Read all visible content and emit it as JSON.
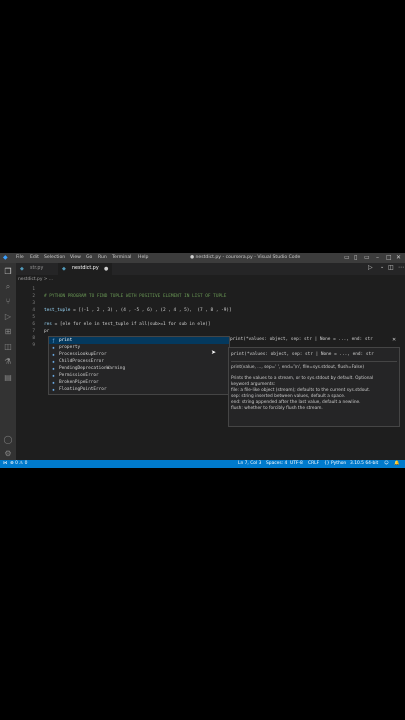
{
  "titlebar": {
    "menus": [
      "File",
      "Edit",
      "Selection",
      "View",
      "Go",
      "Run",
      "Terminal",
      "Help"
    ],
    "title": "● nestdict.py - coursera.py - Visual Studio Code"
  },
  "tabs": [
    {
      "label": "str.py",
      "active": false
    },
    {
      "label": "nestdict.py",
      "active": true
    }
  ],
  "breadcrumb": "nestdict.py > ...",
  "editor": {
    "line_numbers": [
      "1",
      "2",
      "3",
      "4",
      "5",
      "6",
      "7",
      "8",
      "9"
    ],
    "line2_comment": "# PYTHON PROGRAM TO FIND TUPLE WITH POSITIVE ELEMENT IN LIST OF TUPLE",
    "line4_var": "test_tuple",
    "line4_rest": " = [(-1 , 2 , 3) , (4 , -5 , 6) , (2 , 4 , 5),  (7 , 8 , -9)]",
    "line6_var": "res",
    "line6_rest": " = [ele for ele in test_tuple if all(sub>=1 for sub in ele)]",
    "line7_typed": "pr"
  },
  "suggestions": {
    "items": [
      "print",
      "property",
      "ProcessLookupError",
      "ChildProcessError",
      "PendingDeprecationWarning",
      "PermissionError",
      "BrokenPipeError",
      "FloatingPointError"
    ],
    "selected_index": 0,
    "detail": "print(*values: object, sep: str | None = ..., end: str"
  },
  "doc": {
    "signature": "print(*values: object, sep: str | None = ..., end: str",
    "short": "print(value, ..., sep=' ', end='\\n', file=sys.stdout, flush=False)",
    "lines": [
      "Prints the values to a stream, or to sys.stdout by default. Optional",
      "keyword arguments:",
      "file: a file-like object (stream); defaults to the current sys.stdout.",
      "sep: string inserted between values, default a space.",
      "end: string appended after the last value, default a newline.",
      "flush: whether to forcibly flush the stream."
    ]
  },
  "statusbar": {
    "problems": "⊗ 0  ⚠ 0",
    "position": "Ln 7, Col 3",
    "spaces": "Spaces: 4",
    "encoding": "UTF-8",
    "eol": "CRLF",
    "language": "{} Python",
    "interpreter": "3.10.5 64-bit"
  },
  "colors": {
    "editor_bg": "#1e1e1e",
    "statusbar_bg": "#007acc",
    "titlebar_bg": "#3c3c3c",
    "suggest_selected": "#04395e"
  }
}
